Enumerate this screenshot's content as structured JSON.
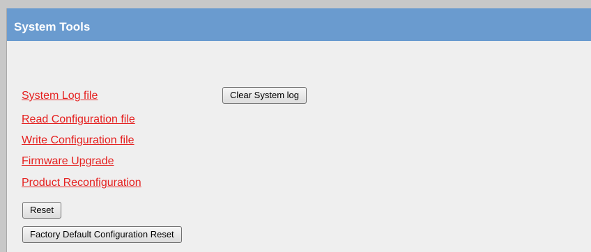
{
  "header": {
    "title": "System Tools"
  },
  "links": {
    "system_log": "System Log file",
    "read_config": "Read Configuration file",
    "write_config": "Write Configuration file",
    "firmware_upgrade": "Firmware Upgrade",
    "product_reconfig": "Product Reconfiguration"
  },
  "buttons": {
    "clear_system_log": "Clear System log",
    "reset": "Reset",
    "factory_reset": "Factory Default Configuration Reset"
  },
  "colors": {
    "header_bg": "#6a9bcf",
    "link": "#e5201f",
    "panel_bg": "#efefef"
  }
}
